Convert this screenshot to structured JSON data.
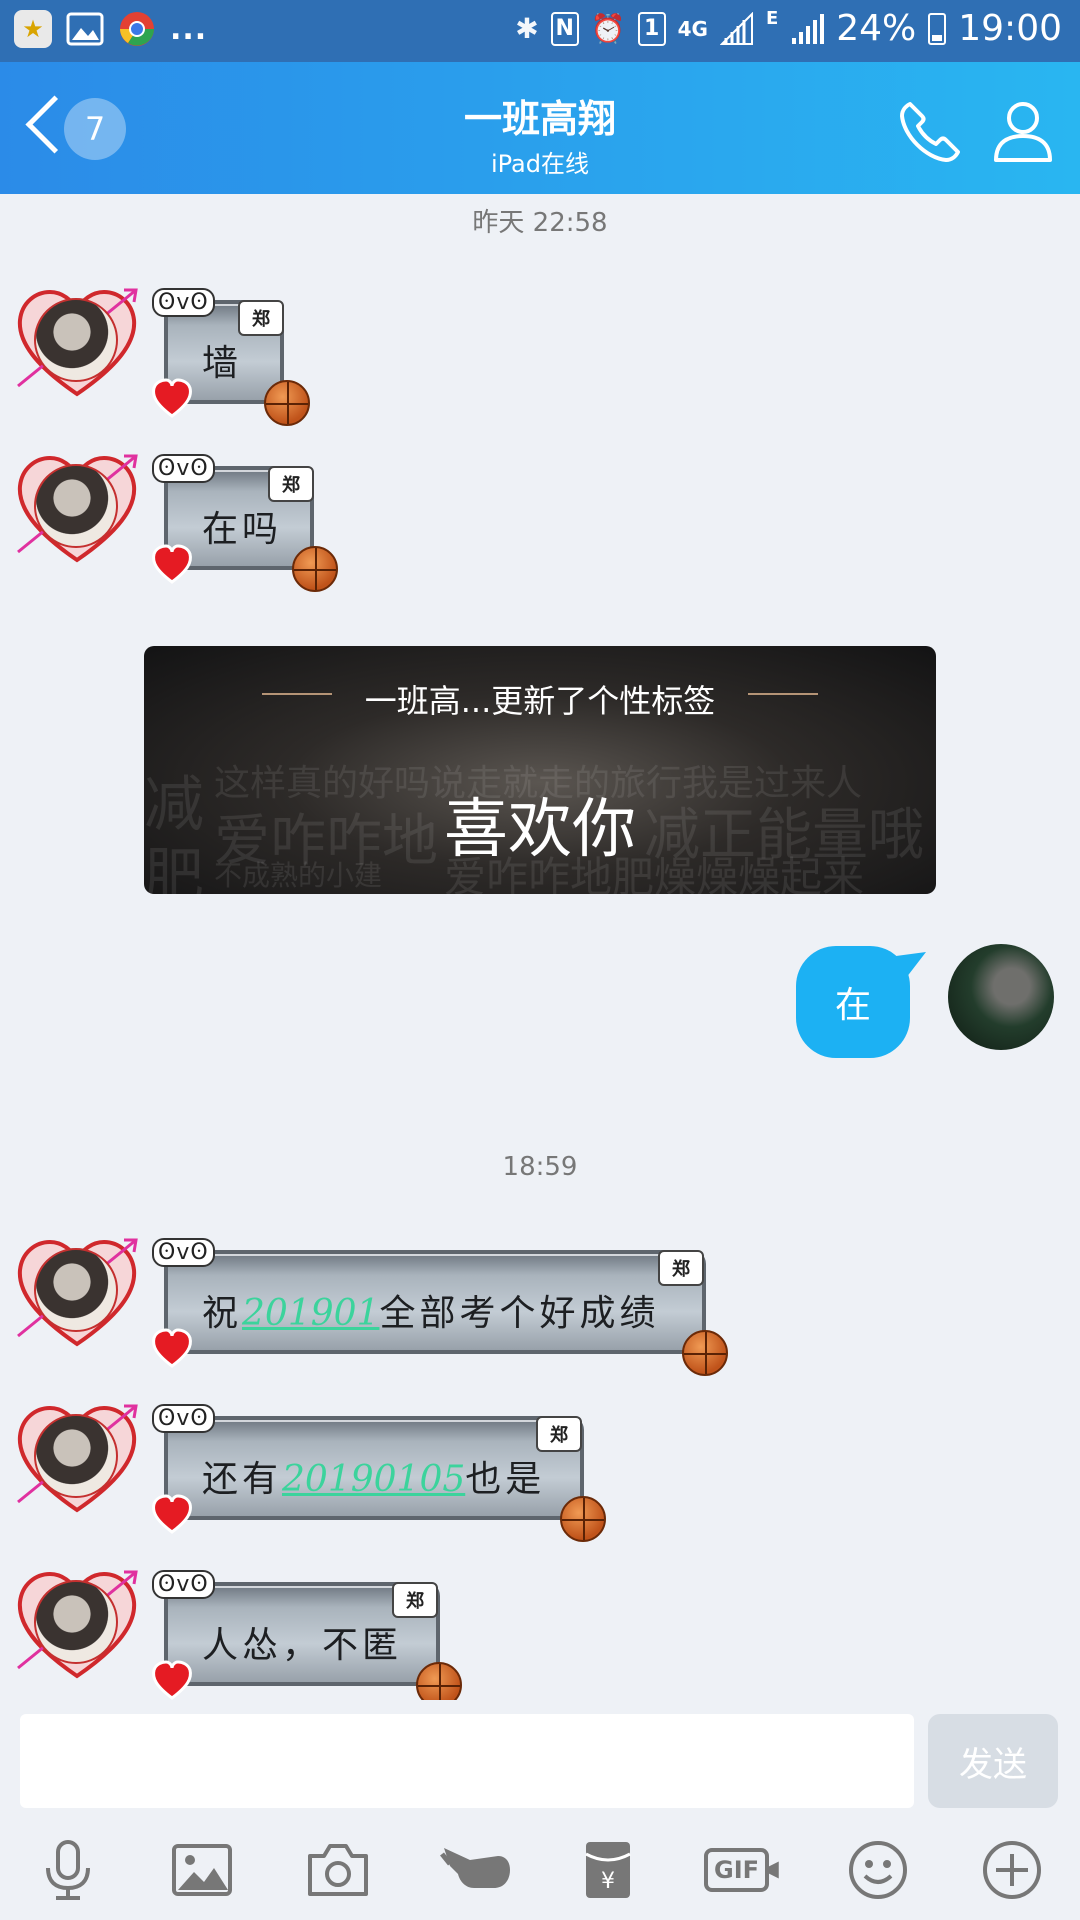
{
  "status_bar": {
    "overflow": "...",
    "network": "4G",
    "edge": "E",
    "battery": "24%",
    "time": "19:00"
  },
  "header": {
    "unread_count": "7",
    "title": "一班高翔",
    "subtitle": "iPad在线"
  },
  "timestamps": {
    "first": "昨天 22:58",
    "second": "18:59"
  },
  "messages": [
    {
      "sender_tag": "郑",
      "text": "墙"
    },
    {
      "sender_tag": "郑",
      "text": "在吗"
    },
    {
      "sender_tag": "郑",
      "text_before": "祝",
      "link": "201901",
      "text_after": "全部考个好成绩"
    },
    {
      "sender_tag": "郑",
      "text_before": "还有",
      "link": "20190105",
      "text_after": "也是"
    },
    {
      "sender_tag": "郑",
      "text": "人怂，不匿"
    }
  ],
  "signature_card": {
    "title": "一班高...更新了个性标签",
    "main": "喜欢你",
    "bg_line1": "这样真的好吗说走就走的旅行我是过来人",
    "bg_line2_a": "减",
    "bg_line2_b": "爱咋咋地",
    "bg_line2_c": "减正能量哦",
    "bg_line3_a": "肥",
    "bg_line3_b": "不成熟的小建",
    "bg_line3_c": "爱咋咋地肥燥燥燥起来"
  },
  "outgoing": {
    "text": "在"
  },
  "input": {
    "value": "",
    "send_label": "发送"
  },
  "toolbar": {
    "gif_label": "GIF"
  },
  "icons": [
    "mic-icon",
    "image-icon",
    "camera-icon",
    "poke-icon",
    "red-packet-icon",
    "gif-icon",
    "emoji-icon",
    "plus-icon"
  ],
  "colors": {
    "header_start": "#2b8be8",
    "header_end": "#29b6f1",
    "outgoing_bubble": "#1cb1f3",
    "link": "#3cd39c",
    "background": "#eef1f6"
  }
}
